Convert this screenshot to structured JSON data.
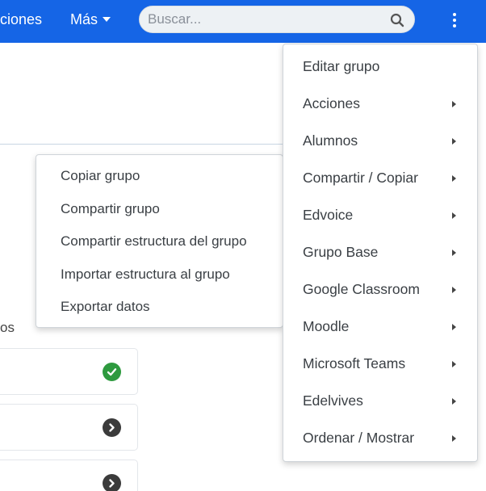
{
  "nav": {
    "acciones_label": "ciones",
    "mas_label": "Más"
  },
  "search": {
    "placeholder": "Buscar...",
    "icon": "search-icon"
  },
  "background": {
    "section_label": "os",
    "cards": [
      {
        "status_icon": "check-circle-icon",
        "status_color": "#2e9a3f"
      },
      {
        "status_icon": "chevron-right-circle-icon",
        "status_color": "#3b3b3b"
      },
      {
        "status_icon": "chevron-right-circle-icon",
        "status_color": "#3b3b3b"
      }
    ]
  },
  "group_menu": {
    "items": [
      {
        "label": "Copiar grupo"
      },
      {
        "label": "Compartir grupo"
      },
      {
        "label": "Compartir estructura del grupo"
      },
      {
        "label": "Importar estructura al grupo"
      },
      {
        "label": "Exportar datos"
      }
    ]
  },
  "main_menu": {
    "items": [
      {
        "label": "Editar grupo",
        "has_submenu": false
      },
      {
        "label": "Acciones",
        "has_submenu": true
      },
      {
        "label": "Alumnos",
        "has_submenu": true
      },
      {
        "label": "Compartir / Copiar",
        "has_submenu": true
      },
      {
        "label": "Edvoice",
        "has_submenu": true
      },
      {
        "label": "Grupo Base",
        "has_submenu": true
      },
      {
        "label": "Google Classroom",
        "has_submenu": true
      },
      {
        "label": "Moodle",
        "has_submenu": true
      },
      {
        "label": "Microsoft Teams",
        "has_submenu": true
      },
      {
        "label": "Edelvives",
        "has_submenu": true
      },
      {
        "label": "Ordenar / Mostrar",
        "has_submenu": true
      }
    ]
  },
  "colors": {
    "topbar": "#1565e6",
    "success": "#2e9a3f"
  }
}
